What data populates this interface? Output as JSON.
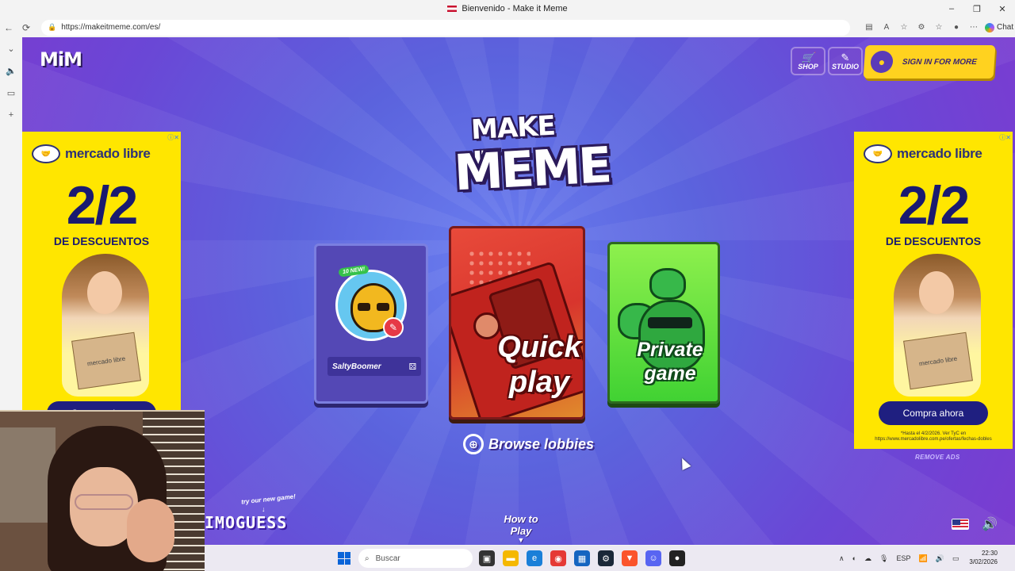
{
  "window": {
    "title": "Bienvenido - Make it Meme",
    "controls": [
      "–",
      "❐",
      "✕"
    ]
  },
  "browser": {
    "url": "https://makeitmeme.com/es/",
    "chat_label": "Chat",
    "toolbar_icons": [
      "reader-icon",
      "read-aloud-icon",
      "favorite-icon",
      "extensions-icon",
      "favorites-bar-icon",
      "profile-icon",
      "more-icon"
    ]
  },
  "site": {
    "logo": "MiM",
    "shop_label": "SHOP",
    "studio_label": "STUDIO",
    "signin_label": "SIGN IN FOR MORE",
    "title_line1": "MAKE IT",
    "title_line2": "MEME",
    "profile": {
      "badge": "10 NEW!",
      "username": "SaltyBoomer"
    },
    "quick_play": "Quick play",
    "private_game": "Private game",
    "browse_lobbies": "Browse lobbies",
    "how_to_play": "How to Play",
    "promo_try": "try our new game!",
    "promo_game": "IMOGUESS",
    "remove_ads": "REMOVE ADS"
  },
  "ads": [
    {
      "brand": "mercado libre",
      "headline": "2/2",
      "subline": "DE DESCUENTOS",
      "box_text": "mercado libre",
      "cta": "Compra ahora",
      "fine_print": "*Hasta el 4/2/2026. Ver TyC en https://www.mercadolibre.com.pe/ofertas/fechas-dobles"
    },
    {
      "brand": "mercado libre",
      "headline": "2/2",
      "subline": "DE DESCUENTOS",
      "box_text": "mercado libre",
      "cta": "Compra ahora",
      "fine_print": "*Hasta el 4/2/2026. Ver TyC en https://www.mercadolibre.com.pe/ofertas/fechas-dobles"
    }
  ],
  "taskbar": {
    "search_placeholder": "Buscar",
    "language": "ESP",
    "time": "22:30",
    "date": "3/02/2026"
  },
  "colors": {
    "page_bg": "#5b63dd",
    "signin_bg": "#ffd21f",
    "quick_play_bg": "#d8352d",
    "private_game_bg": "#41d233",
    "ad_bg": "#ffe600"
  }
}
